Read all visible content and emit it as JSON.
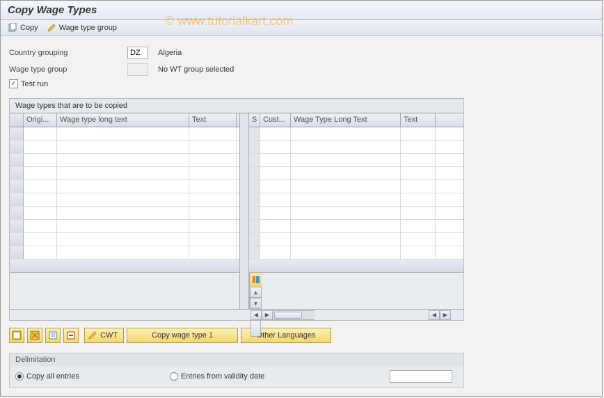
{
  "title": "Copy Wage Types",
  "watermark": "© www.tutorialkart.com",
  "toolbar": {
    "copy_label": "Copy",
    "wage_type_group_label": "Wage type group"
  },
  "form": {
    "country_grouping_label": "Country grouping",
    "country_grouping_value": "DZ",
    "country_grouping_text": "Algeria",
    "wage_type_group_label": "Wage type group",
    "wage_type_group_value": "",
    "wage_type_group_text": "No WT group selected",
    "test_run_label": "Test run",
    "test_run_checked": true
  },
  "grid": {
    "panel_title": "Wage types that are to be copied",
    "headers_left": [
      "Origi...",
      "Wage type long text",
      "Text"
    ],
    "headers_right": [
      "S",
      "Cust...",
      "Wage Type Long Text",
      "Text"
    ],
    "row_count": 10
  },
  "buttons": {
    "cwt_label": "CWT",
    "copy_wage_type_1": "Copy wage type 1",
    "other_languages": "Other Languages"
  },
  "delimitation": {
    "title": "Delimitation",
    "copy_all_label": "Copy all entries",
    "entries_from_label": "Entries from validity date",
    "selected": "copy_all"
  }
}
